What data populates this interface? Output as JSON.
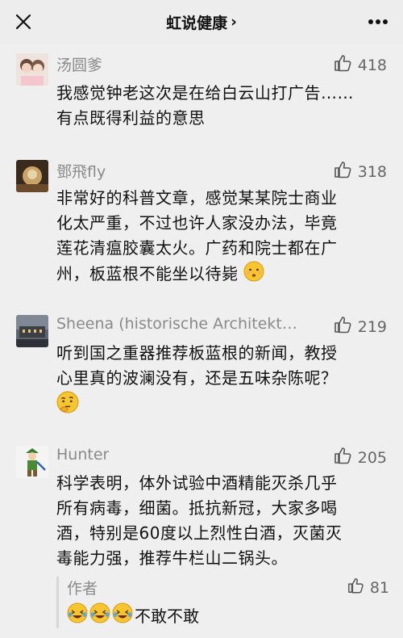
{
  "header": {
    "title": "虹说健康",
    "chevron": "›"
  },
  "icons": {
    "close": "close-icon",
    "more": "more-icon",
    "like": "thumb-up-icon"
  },
  "comments": [
    {
      "name": "汤圆爹",
      "likes": "418",
      "lines": [
        "我感觉钟老这次是在给白云山打广告……",
        "有点既得利益的意思"
      ]
    },
    {
      "name": "鄧飛fly",
      "likes": "318",
      "lines": [
        "非常好的科普文章，感觉某某院士商业",
        "化太严重，不过也许人家没办法，毕竟",
        "莲花清瘟胶囊太火。广药和院士都在广",
        "州，板蓝根不能坐以待毙"
      ]
    },
    {
      "name": "Sheena (historische Architekt…",
      "likes": "219",
      "lines": [
        "听到国之重器推荐板蓝根的新闻，教授",
        "心里真的波澜没有，还是五味杂陈呢？"
      ]
    },
    {
      "name": "Hunter",
      "likes": "205",
      "lines": [
        "科学表明，体外试验中酒精能灭杀几乎",
        "所有病毒，细菌。抵抗新冠，大家多喝",
        "酒，特别是60度以上烈性白酒，灭菌灭",
        "毒能力强，推荐牛栏山二锅头。"
      ]
    }
  ],
  "author_reply": {
    "label": "作者",
    "likes": "81",
    "text": "不敢不敢"
  }
}
